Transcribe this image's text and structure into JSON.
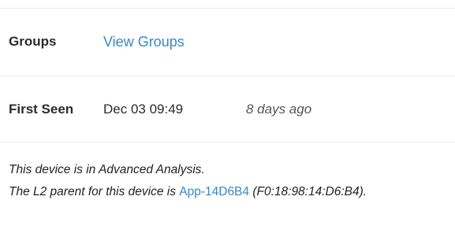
{
  "groups": {
    "label": "Groups",
    "link_text": "View Groups"
  },
  "first_seen": {
    "label": "First Seen",
    "date": "Dec 03 09:49",
    "relative": "8 days ago"
  },
  "notes": {
    "analysis": "This device is in Advanced Analysis.",
    "l2_prefix": "The L2 parent for this device is ",
    "l2_parent_link": "App-14D6B4",
    "l2_mac": " (F0:18:98:14:D6:B4)."
  },
  "colors": {
    "link": "#3a87c1",
    "divider": "#ececec",
    "text": "#2b2b2b"
  }
}
